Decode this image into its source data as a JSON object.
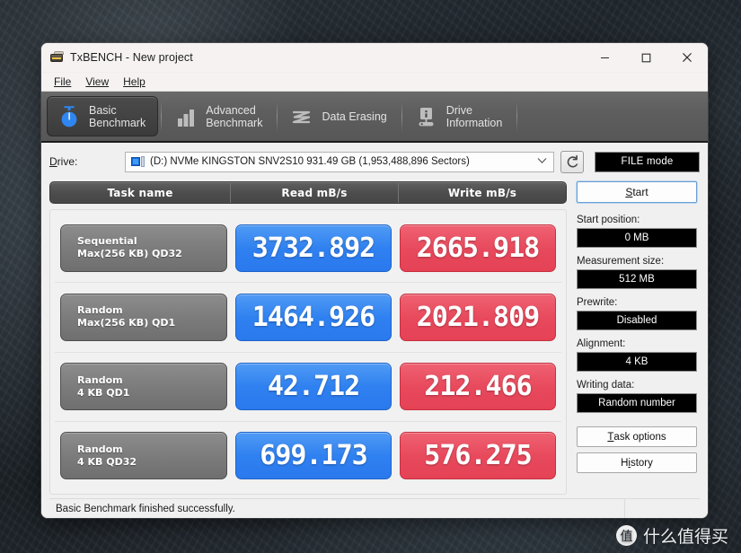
{
  "window": {
    "title": "TxBENCH - New project",
    "icon": "drive-app-icon",
    "controls": {
      "minimize": "minimize-icon",
      "maximize": "maximize-icon",
      "close": "close-icon"
    }
  },
  "menubar": {
    "items": [
      {
        "label": "File",
        "accel": "F"
      },
      {
        "label": "View",
        "accel": "V"
      },
      {
        "label": "Help",
        "accel": "H"
      }
    ]
  },
  "toolbar": {
    "tabs": [
      {
        "line1": "Basic",
        "line2": "Benchmark",
        "icon": "stopwatch-icon",
        "active": true
      },
      {
        "line1": "Advanced",
        "line2": "Benchmark",
        "icon": "bar-chart-icon",
        "active": false
      },
      {
        "line1": "Data Erasing",
        "line2": "",
        "icon": "eraser-wave-icon",
        "active": false
      },
      {
        "line1": "Drive",
        "line2": "Information",
        "icon": "drive-info-icon",
        "active": false
      }
    ]
  },
  "drive": {
    "label": "Drive:",
    "accel": "D",
    "selected": "(D:) NVMe KINGSTON SNV2S10  931.49 GB (1,953,488,896 Sectors)",
    "refresh_icon": "refresh-icon",
    "mode_button": "FILE mode"
  },
  "table": {
    "headers": [
      "Task name",
      "Read mB/s",
      "Write mB/s"
    ],
    "rows": [
      {
        "task_line1": "Sequential",
        "task_line2": "Max(256 KB) QD32",
        "read": "3732.892",
        "write": "2665.918"
      },
      {
        "task_line1": "Random",
        "task_line2": "Max(256 KB) QD1",
        "read": "1464.926",
        "write": "2021.809"
      },
      {
        "task_line1": "Random",
        "task_line2": "4 KB QD1",
        "read": "42.712",
        "write": "212.466"
      },
      {
        "task_line1": "Random",
        "task_line2": "4 KB QD32",
        "read": "699.173",
        "write": "576.275"
      }
    ]
  },
  "panel": {
    "start_button": "Start",
    "start_accel": "S",
    "fields": [
      {
        "label": "Start position:",
        "value": "0 MB"
      },
      {
        "label": "Measurement size:",
        "value": "512 MB"
      },
      {
        "label": "Prewrite:",
        "value": "Disabled"
      },
      {
        "label": "Alignment:",
        "value": "4 KB"
      },
      {
        "label": "Writing data:",
        "value": "Random number"
      }
    ],
    "buttons": [
      {
        "label": "Task options",
        "accel": "T"
      },
      {
        "label": "History",
        "accel": "i"
      }
    ]
  },
  "statusbar": {
    "message": "Basic Benchmark finished successfully."
  },
  "watermark": {
    "badge": "值",
    "text": "什么值得买"
  },
  "colors": {
    "read_pill": "#2f80f0",
    "write_pill": "#e8495c",
    "task_pill": "#7c7c7c",
    "field_bg": "#000000",
    "toolbar_bg": "#5e5e5e"
  }
}
